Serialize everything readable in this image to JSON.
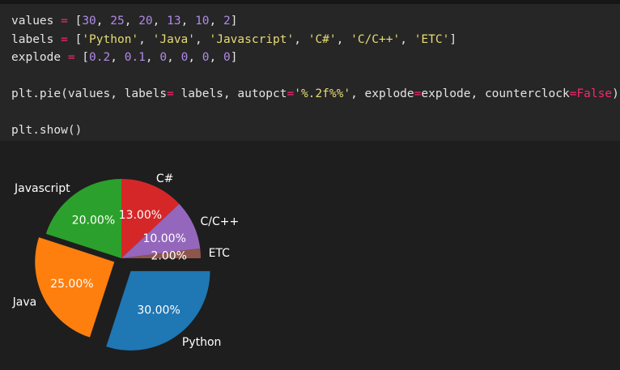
{
  "code_lines": [
    {
      "name": "line-values",
      "tokens": [
        {
          "t": "values ",
          "c": "plain"
        },
        {
          "t": "=",
          "c": "op"
        },
        {
          "t": " [",
          "c": "plain"
        },
        {
          "t": "30",
          "c": "num"
        },
        {
          "t": ", ",
          "c": "plain"
        },
        {
          "t": "25",
          "c": "num"
        },
        {
          "t": ", ",
          "c": "plain"
        },
        {
          "t": "20",
          "c": "num"
        },
        {
          "t": ", ",
          "c": "plain"
        },
        {
          "t": "13",
          "c": "num"
        },
        {
          "t": ", ",
          "c": "plain"
        },
        {
          "t": "10",
          "c": "num"
        },
        {
          "t": ", ",
          "c": "plain"
        },
        {
          "t": "2",
          "c": "num"
        },
        {
          "t": "]",
          "c": "plain"
        }
      ]
    },
    {
      "name": "line-labels",
      "tokens": [
        {
          "t": "labels ",
          "c": "plain"
        },
        {
          "t": "=",
          "c": "op"
        },
        {
          "t": " [",
          "c": "plain"
        },
        {
          "t": "'Python'",
          "c": "str"
        },
        {
          "t": ", ",
          "c": "plain"
        },
        {
          "t": "'Java'",
          "c": "str"
        },
        {
          "t": ", ",
          "c": "plain"
        },
        {
          "t": "'Javascript'",
          "c": "str"
        },
        {
          "t": ", ",
          "c": "plain"
        },
        {
          "t": "'C#'",
          "c": "str"
        },
        {
          "t": ", ",
          "c": "plain"
        },
        {
          "t": "'C/C++'",
          "c": "str"
        },
        {
          "t": ", ",
          "c": "plain"
        },
        {
          "t": "'ETC'",
          "c": "str"
        },
        {
          "t": "]",
          "c": "plain"
        }
      ]
    },
    {
      "name": "line-explode",
      "tokens": [
        {
          "t": "explode ",
          "c": "plain"
        },
        {
          "t": "=",
          "c": "op"
        },
        {
          "t": " [",
          "c": "plain"
        },
        {
          "t": "0.2",
          "c": "num"
        },
        {
          "t": ", ",
          "c": "plain"
        },
        {
          "t": "0.1",
          "c": "num"
        },
        {
          "t": ", ",
          "c": "plain"
        },
        {
          "t": "0",
          "c": "num"
        },
        {
          "t": ", ",
          "c": "plain"
        },
        {
          "t": "0",
          "c": "num"
        },
        {
          "t": ", ",
          "c": "plain"
        },
        {
          "t": "0",
          "c": "num"
        },
        {
          "t": ", ",
          "c": "plain"
        },
        {
          "t": "0",
          "c": "num"
        },
        {
          "t": "]",
          "c": "plain"
        }
      ]
    },
    {
      "name": "line-blank-1",
      "tokens": []
    },
    {
      "name": "line-pie-call",
      "tokens": [
        {
          "t": "plt.pie(values, labels",
          "c": "plain"
        },
        {
          "t": "=",
          "c": "op"
        },
        {
          "t": " labels, autopct",
          "c": "plain"
        },
        {
          "t": "=",
          "c": "op"
        },
        {
          "t": "'%.2f%%'",
          "c": "str"
        },
        {
          "t": ", explode",
          "c": "plain"
        },
        {
          "t": "=",
          "c": "op"
        },
        {
          "t": "explode, counterclock",
          "c": "plain"
        },
        {
          "t": "=",
          "c": "op"
        },
        {
          "t": "False",
          "c": "kw"
        },
        {
          "t": ")",
          "c": "plain"
        }
      ]
    },
    {
      "name": "line-blank-2",
      "tokens": []
    },
    {
      "name": "line-show",
      "tokens": [
        {
          "t": "plt.show()",
          "c": "plain"
        }
      ]
    }
  ],
  "chart_data": {
    "type": "pie",
    "labels": [
      "Python",
      "Java",
      "Javascript",
      "C#",
      "C/C++",
      "ETC"
    ],
    "values": [
      30,
      25,
      20,
      13,
      10,
      2
    ],
    "explode": [
      0.2,
      0.1,
      0,
      0,
      0,
      0
    ],
    "autopct_labels": [
      "30.00%",
      "25.00%",
      "20.00%",
      "13.00%",
      "10.00%",
      "2.00%"
    ],
    "colors": [
      "#1f77b4",
      "#ff7f0e",
      "#2ca02c",
      "#d62728",
      "#9467bd",
      "#8c564b"
    ],
    "counterclock": false,
    "startangle": 0
  },
  "theme": {
    "label_color": "#ffffff",
    "pct_color": "#ffffff"
  }
}
